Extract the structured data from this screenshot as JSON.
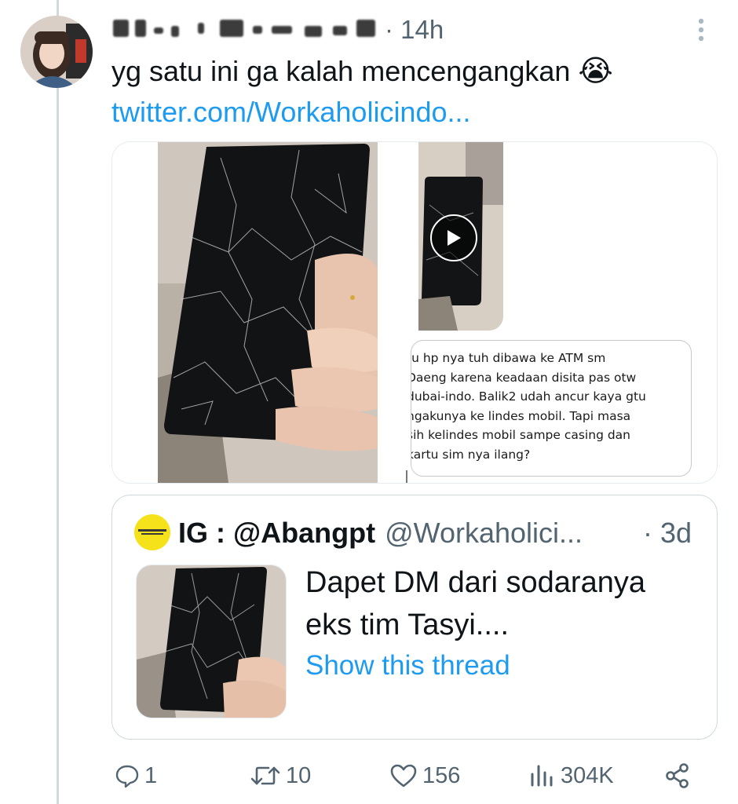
{
  "tweet": {
    "time": "· 14h",
    "text": "yg satu ini ga kalah mencengangkan",
    "emoji": "😭",
    "link": "twitter.com/Workaholicindo..."
  },
  "media": {
    "dm_text": "tu hp nya tuh dibawa ke ATM sm\nDaeng karena keadaan disita pas otw\ndubai-indo. Balik2 udah ancur kaya gtu\nngakunya ke lindes mobil. Tapi masa\nsih kelindes mobil sampe casing dan\nkartu sim nya ilang?"
  },
  "quote": {
    "name": "IG : @Abangpt",
    "handle": "@Workaholici...",
    "time": "· 3d",
    "text": "Dapet DM dari sodaranya eks tim Tasyi....",
    "show_thread": "Show this thread"
  },
  "actions": {
    "replies": "1",
    "retweets": "10",
    "likes": "156",
    "views": "304K"
  },
  "colors": {
    "accent": "#1d9bf0",
    "muted": "#536471",
    "text": "#0f1419"
  }
}
